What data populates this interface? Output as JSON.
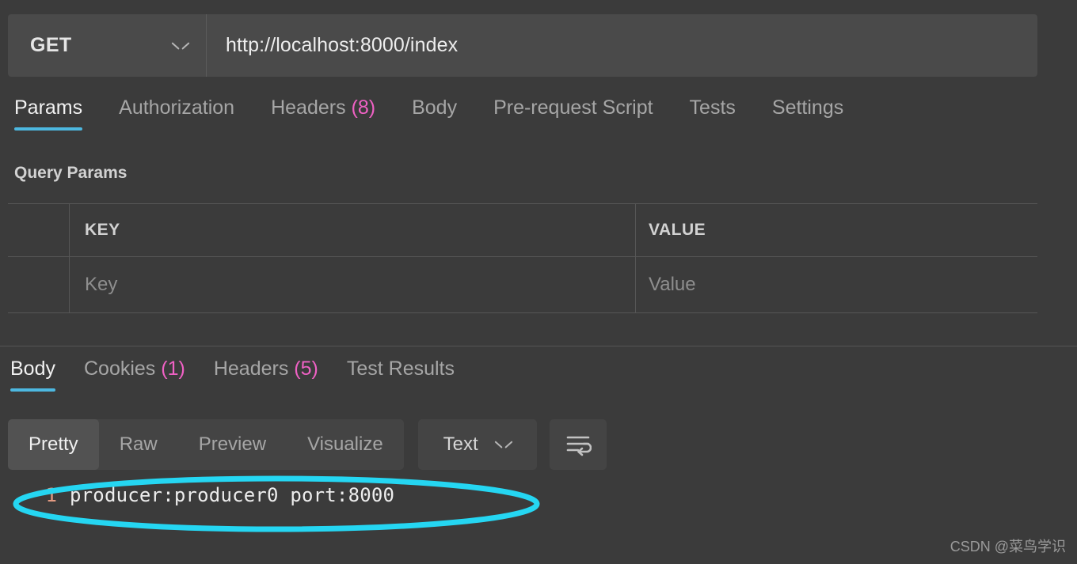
{
  "request": {
    "method": "GET",
    "url": "http://localhost:8000/index",
    "tabs": [
      {
        "label": "Params",
        "count": "",
        "active": true
      },
      {
        "label": "Authorization",
        "count": "",
        "active": false
      },
      {
        "label": "Headers",
        "count": "(8)",
        "active": false
      },
      {
        "label": "Body",
        "count": "",
        "active": false
      },
      {
        "label": "Pre-request Script",
        "count": "",
        "active": false
      },
      {
        "label": "Tests",
        "count": "",
        "active": false
      },
      {
        "label": "Settings",
        "count": "",
        "active": false
      }
    ],
    "query_params": {
      "title": "Query Params",
      "columns": [
        "KEY",
        "VALUE"
      ],
      "rows": [
        {
          "key_placeholder": "Key",
          "value_placeholder": "Value"
        }
      ]
    }
  },
  "response": {
    "tabs": [
      {
        "label": "Body",
        "count": "",
        "active": true
      },
      {
        "label": "Cookies",
        "count": "(1)",
        "active": false
      },
      {
        "label": "Headers",
        "count": "(5)",
        "active": false
      },
      {
        "label": "Test Results",
        "count": "",
        "active": false
      }
    ],
    "view_modes": [
      {
        "label": "Pretty",
        "active": true
      },
      {
        "label": "Raw",
        "active": false
      },
      {
        "label": "Preview",
        "active": false
      },
      {
        "label": "Visualize",
        "active": false
      }
    ],
    "format_dropdown": "Text",
    "wrap_icon": "wrap-lines-icon",
    "body_lines": [
      {
        "number": "1",
        "text": "producer:producer0 port:8000"
      }
    ]
  },
  "annotation": {
    "shape": "ellipse",
    "color": "#25d6f2"
  },
  "watermark": "CSDN @菜鸟学识",
  "colors": {
    "accent_tab": "#4db8e0",
    "count_pink": "#ef61c4",
    "line_number": "#e39a82",
    "annotation_cyan": "#25d6f2"
  }
}
